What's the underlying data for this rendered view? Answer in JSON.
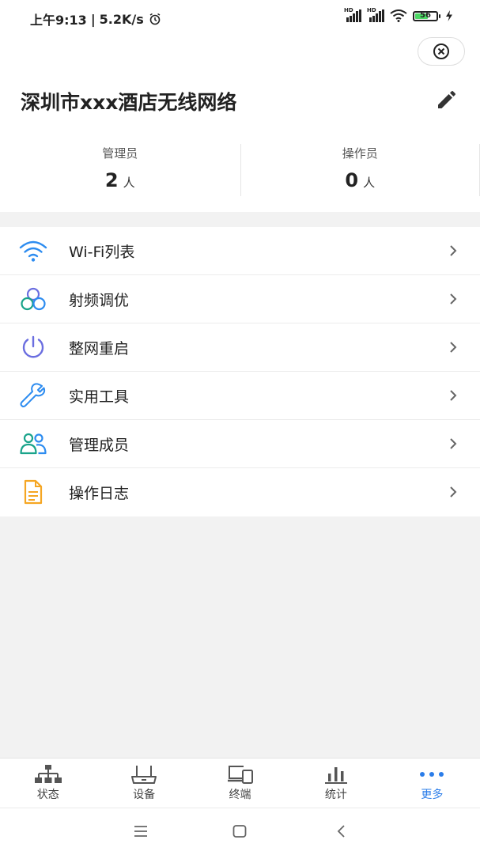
{
  "status_bar": {
    "time": "上午9:13",
    "separator": "|",
    "net_speed": "5.2K/s",
    "signal_1_label": "HD",
    "signal_2_label": "HD",
    "battery_level": "56"
  },
  "header": {
    "network_name": "深圳市xxx酒店无线网络"
  },
  "stats": {
    "admin_label": "管理员",
    "admin_count": "2",
    "admin_unit": "人",
    "operator_label": "操作员",
    "operator_count": "0",
    "operator_unit": "人"
  },
  "menu": {
    "items": [
      {
        "label": "Wi-Fi列表",
        "icon": "wifi-icon"
      },
      {
        "label": "射频调优",
        "icon": "rf-circles-icon"
      },
      {
        "label": "整网重启",
        "icon": "power-icon"
      },
      {
        "label": "实用工具",
        "icon": "wrench-icon"
      },
      {
        "label": "管理成员",
        "icon": "members-icon"
      },
      {
        "label": "操作日志",
        "icon": "log-document-icon"
      }
    ]
  },
  "tabbar": {
    "tabs": [
      {
        "label": "状态",
        "icon": "topology-icon"
      },
      {
        "label": "设备",
        "icon": "router-icon"
      },
      {
        "label": "终端",
        "icon": "devices-icon"
      },
      {
        "label": "统计",
        "icon": "bar-chart-icon"
      },
      {
        "label": "更多",
        "icon": "more-dots-icon"
      }
    ],
    "active_index": 4
  },
  "colors": {
    "accent": "#2b7de9",
    "wifi": "#2d8cf0",
    "power": "#6b6ee0",
    "members": "#19a38a",
    "log": "#f5a623"
  }
}
